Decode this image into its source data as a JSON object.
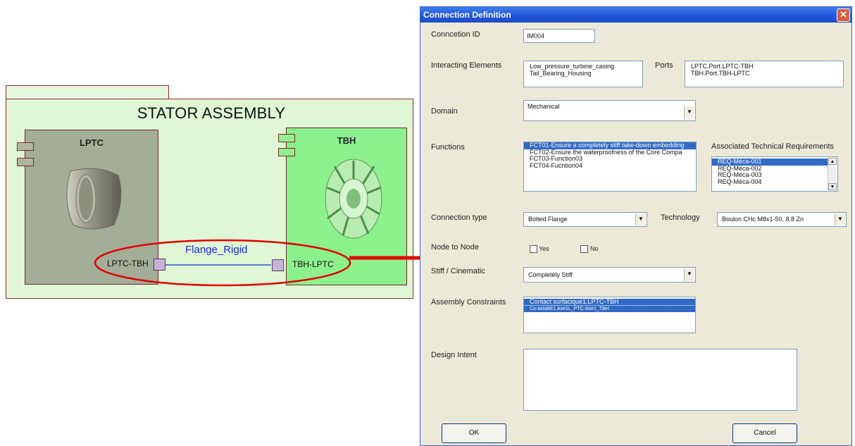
{
  "diagram": {
    "package_title": "STATOR ASSEMBLY",
    "lptc": {
      "name": "LPTC",
      "port_label": "LPTC-TBH"
    },
    "tbh": {
      "name": "TBH",
      "port_label": "TBH-LPTC"
    },
    "link_label": "Flange_Rigid",
    "colors": {
      "package_bg": "#dff7d5",
      "lptc_bg": "#a3ad98",
      "tbh_bg": "#8cf08c",
      "link": "#1a2ad8",
      "highlight": "#e00000"
    }
  },
  "dialog": {
    "title": "Connection Definition",
    "close_icon": "close-icon",
    "connection_id": {
      "label": "Conncetion ID",
      "value": "IM004"
    },
    "interacting_elements": {
      "label": "Interacting Elements",
      "values": [
        "Low_pressure_turbine_casing",
        "Tail_Bearing_Housing"
      ]
    },
    "ports": {
      "label": "Ports",
      "values": [
        "LPTC.Port.LPTC-TBH",
        "TBH.Port.TBH-LPTC"
      ]
    },
    "domain": {
      "label": "Domain",
      "value": "Mechanical"
    },
    "functions": {
      "label": "Functions",
      "items": [
        "FCT01-Ensure a completely stiff take-down embedding",
        "FCT02-Ensure the waterproofness of the Core Compa",
        "FCT03-Function03",
        "FCT04-Fucntion04"
      ],
      "selected_index": 0
    },
    "requirements": {
      "label": "Associated Technical Requirements",
      "items": [
        "REQ-Méca-001",
        "REQ-Méca-002",
        "REQ-Méca-003",
        "REQ-Méca-004"
      ],
      "selected_index": 0
    },
    "connection_type": {
      "label": "Connection type",
      "value": "Bolted Flange"
    },
    "technology": {
      "label": "Technology",
      "value": "Boulon CHc M8x1-50, 8.8 Zn"
    },
    "node_to_node": {
      "label": "Node to Node",
      "yes_label": "Yes",
      "no_label": "No"
    },
    "stiff": {
      "label": "Stiff / Cinematic",
      "value": "Completely Stiff"
    },
    "assembly_constraints": {
      "label": "Assembly Constraints",
      "items": [
        "Contact surfacique1.LPTC-TBH",
        "Co-axialité1.Axe1L_PTC-Axe1_TBH"
      ]
    },
    "design_intent": {
      "label": "Design Intent",
      "value": ""
    },
    "ok_label": "OK",
    "cancel_label": "Cancel"
  }
}
